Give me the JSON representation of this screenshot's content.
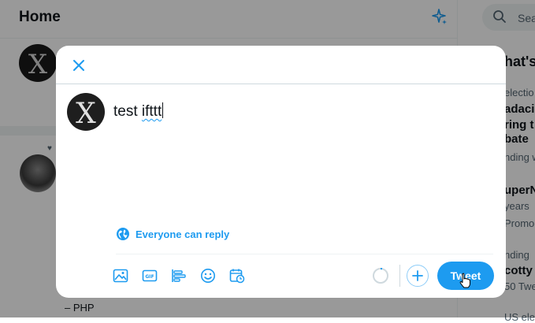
{
  "background": {
    "header_title": "Home",
    "search_placeholder": "Sea",
    "right_column": [
      "hat's",
      "electio",
      "adacio",
      "ring t",
      "bate",
      "nding w",
      "uperN",
      "years",
      "Promo",
      "nding",
      "cotty",
      "50 Twe",
      "US electio"
    ],
    "list_item_text": "– PHP"
  },
  "composer": {
    "text_main": "test ",
    "text_typo": "ifttt",
    "reply_setting_label": "Everyone can reply",
    "tweet_button_label": "Tweet"
  },
  "colors": {
    "accent": "#1d9bf0",
    "overlay": "rgba(0,0,0,0.40)"
  },
  "icons": [
    "close-icon",
    "globe-icon",
    "image-icon",
    "gif-icon",
    "poll-icon",
    "emoji-icon",
    "schedule-icon",
    "add-icon",
    "sparkle-icon",
    "search-icon"
  ]
}
